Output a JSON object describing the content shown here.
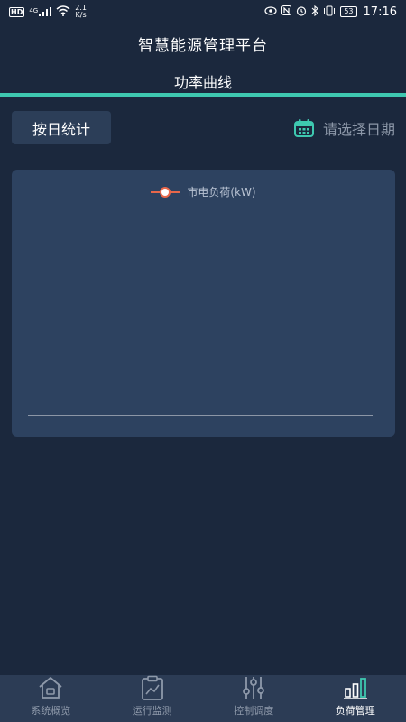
{
  "status_bar": {
    "network_badge": "HD",
    "signal_label": "4G",
    "speed_value": "2.1",
    "speed_unit": "K/s",
    "battery": "53",
    "time": "17:16"
  },
  "header": {
    "app_title": "智慧能源管理平台",
    "page_title": "功率曲线"
  },
  "colors": {
    "accent": "#3ec8b0",
    "background": "#1b283d",
    "card": "#2d4260",
    "series": "#e8674a"
  },
  "toolbar": {
    "mode_label": "按日统计",
    "date_placeholder": "请选择日期",
    "date_icon": "calendar-icon"
  },
  "chart_data": {
    "type": "line",
    "series": [
      {
        "name": "市电负荷(kW)",
        "values": []
      }
    ],
    "legend_position": "top-center",
    "grid": false
  },
  "bottom_nav": {
    "items": [
      {
        "label": "系统概览",
        "icon": "home-icon",
        "active": false
      },
      {
        "label": "运行监测",
        "icon": "clipboard-chart-icon",
        "active": false
      },
      {
        "label": "控制调度",
        "icon": "sliders-icon",
        "active": false
      },
      {
        "label": "负荷管理",
        "icon": "bar-chart-icon",
        "active": true
      }
    ]
  }
}
